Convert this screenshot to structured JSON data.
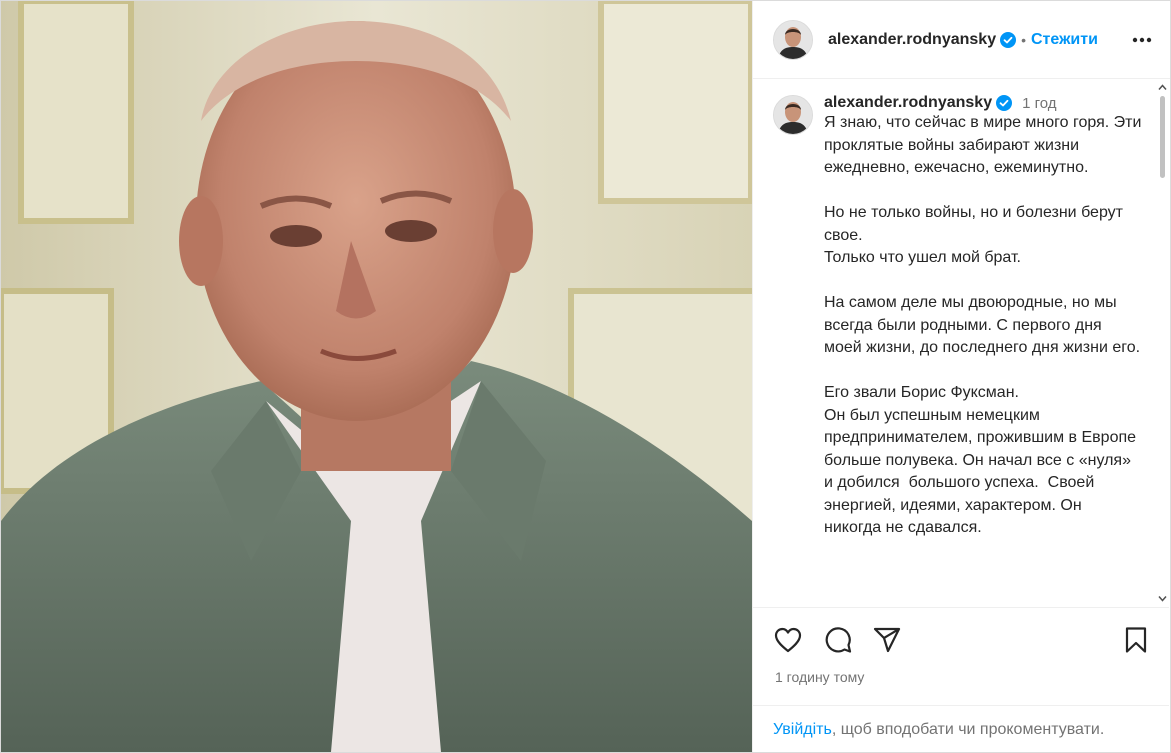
{
  "header": {
    "username": "alexander.rodnyansky",
    "separator": "•",
    "follow_label": "Стежити"
  },
  "caption": {
    "username": "alexander.rodnyansky",
    "time_short": "1 год",
    "text": "Я знаю, что сейчас в мире много горя. Эти проклятые войны забирают жизни ежедневно, ежечасно, ежеминутно.\n\nНо не только войны, но и болезни берут свое.\nТолько что ушел мой брат.\n\nНа самом деле мы двоюродные, но мы всегда были родными. С первого дня моей жизни, до последнего дня жизни его.\n\nЕго звали Борис Фуксман.\nОн был успешным немецким предпринимателем, прожившим в Европе больше полувека. Он начал все с «нуля» и добился  большого успеха.  Своей энергией, идеями, характером. Он никогда не сдавался."
  },
  "post_time": "1 годину тому",
  "login": {
    "link": "Увійдіть",
    "rest": ", щоб вподобати чи прокоментувати."
  },
  "colors": {
    "accent": "#0095f6",
    "verified": "#0095f6",
    "muted": "#737373",
    "text": "#262626"
  },
  "icons": [
    "verified-badge-icon",
    "more-options-icon",
    "heart-icon",
    "comment-icon",
    "share-icon",
    "bookmark-icon"
  ]
}
